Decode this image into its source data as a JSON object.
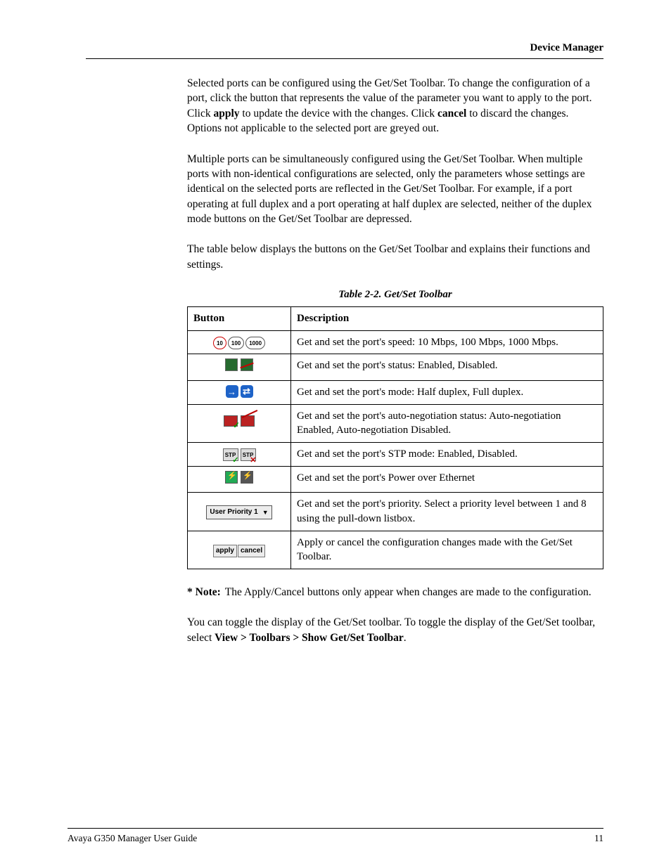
{
  "header": {
    "title": "Device Manager"
  },
  "paragraphs": {
    "p1_a": "Selected ports can be configured using the Get/Set Toolbar. To change the configuration of a port, click the button that represents the value of the parameter you want to apply to the port. Click ",
    "p1_apply": "apply",
    "p1_b": " to update the device with the changes. Click ",
    "p1_cancel": "cancel",
    "p1_c": " to discard the changes. Options not applicable to the selected port are greyed out.",
    "p2": "Multiple ports can be simultaneously configured using the Get/Set Toolbar. When multiple ports with non-identical configurations are selected, only the parameters whose settings are identical on the selected ports are reflected in the Get/Set Toolbar. For example, if a port operating at full duplex and a port operating at half duplex are selected, neither of the duplex mode buttons on the Get/Set Toolbar are depressed.",
    "p3": "The table below displays the buttons on the Get/Set Toolbar and explains their functions and settings.",
    "p4_a": "You can toggle the display of the Get/Set toolbar. To toggle the display of the Get/Set toolbar, select ",
    "p4_menu": "View > Toolbars > Show Get/Set Toolbar",
    "p4_b": "."
  },
  "table": {
    "caption": "Table 2-2.  Get/Set Toolbar",
    "head_button": "Button",
    "head_desc": "Description",
    "rows": [
      {
        "desc": "Get and set the port's speed: 10 Mbps, 100 Mbps, 1000 Mbps."
      },
      {
        "desc": "Get and set the port's status: Enabled, Disabled."
      },
      {
        "desc": "Get and set the port's mode: Half duplex, Full duplex."
      },
      {
        "desc": "Get and set the port's auto-negotiation status: Auto-negotiation Enabled, Auto-negotiation Disabled."
      },
      {
        "desc": "Get and set the port's STP mode: Enabled, Disabled."
      },
      {
        "desc": "Get and set the port's Power over Ethernet"
      },
      {
        "desc": "Get and set the port's priority. Select a priority level between 1 and 8 using the pull-down listbox."
      },
      {
        "desc": "Apply or cancel the configuration changes made with the Get/Set Toolbar."
      }
    ]
  },
  "icons": {
    "speed10": "10",
    "speed100": "100",
    "speed1000": "1000",
    "half": "→",
    "full": "⇄",
    "stp": "STP",
    "priority_label": "User Priority 1",
    "apply": "apply",
    "cancel": "cancel"
  },
  "note": {
    "label": "* Note:",
    "text": "The Apply/Cancel buttons only appear when changes are made to the configuration."
  },
  "footer": {
    "left": "Avaya G350 Manager User Guide",
    "right": "11"
  }
}
